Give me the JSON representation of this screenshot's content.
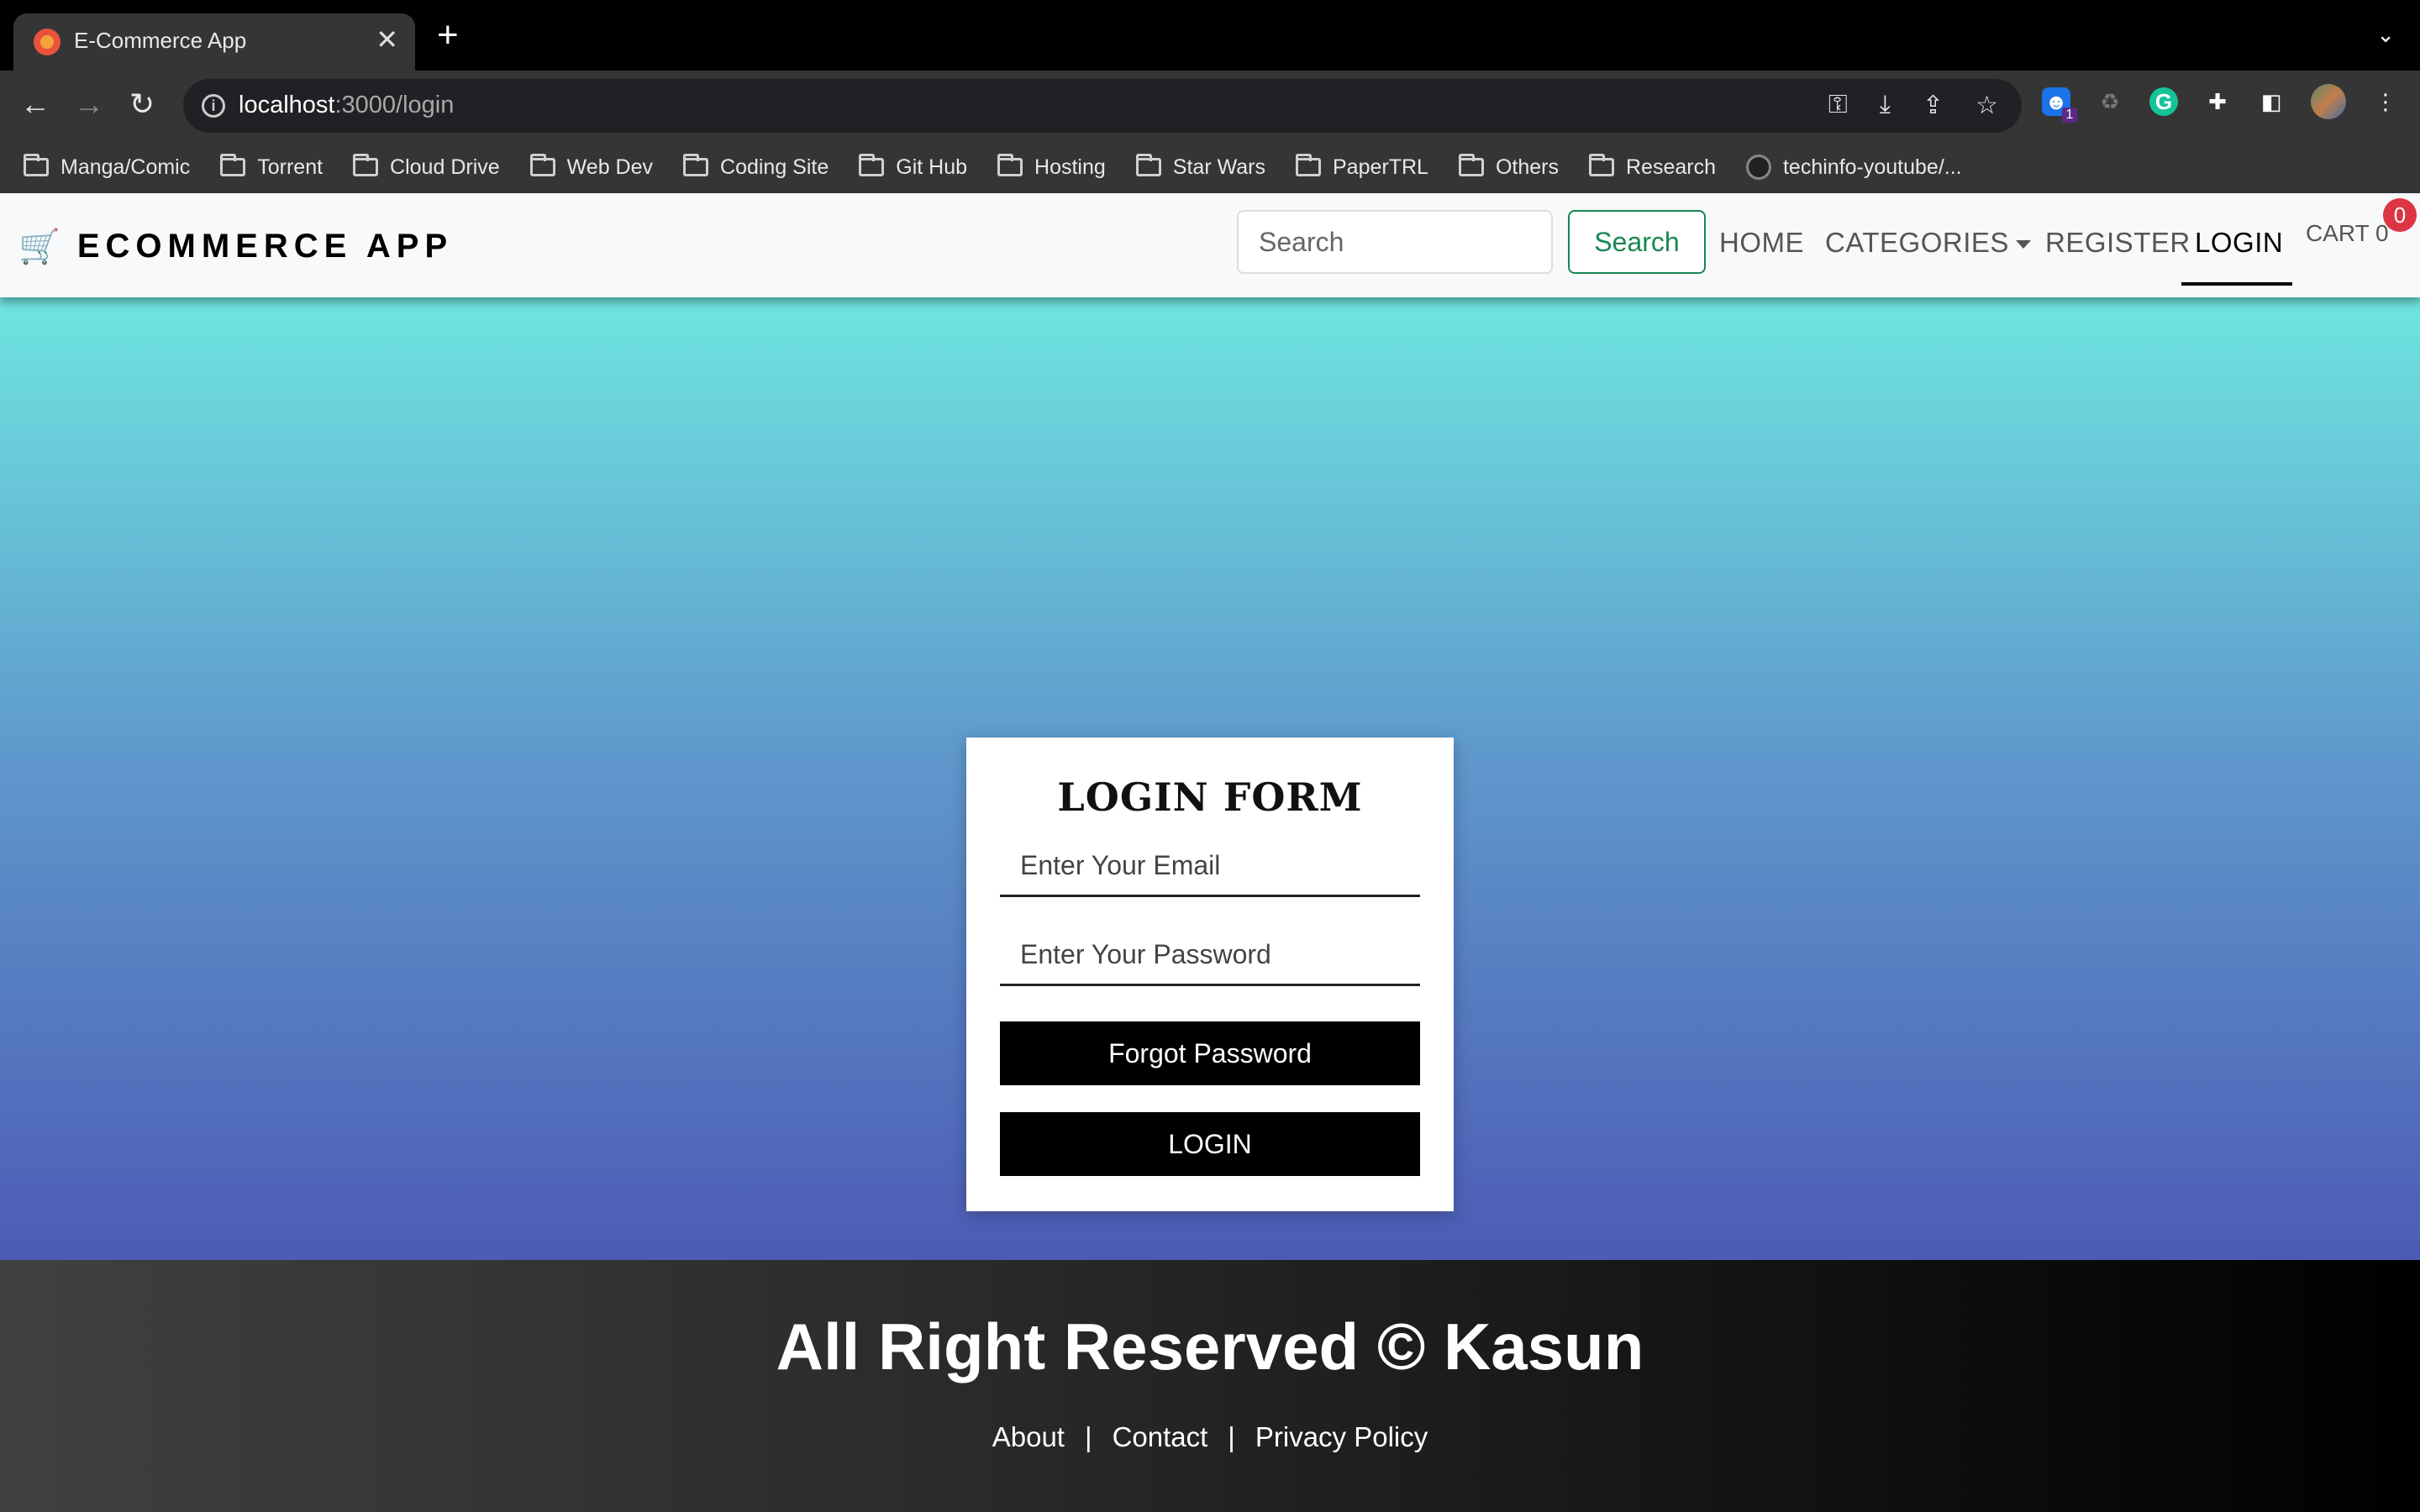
{
  "browser": {
    "tab_title": "E-Commerce App",
    "url_host": "localhost",
    "url_rest": ":3000/login",
    "extension_badge": "1",
    "bookmarks": [
      "Manga/Comic",
      "Torrent",
      "Cloud Drive",
      "Web Dev",
      "Coding Site",
      "Git Hub",
      "Hosting",
      "Star Wars",
      "PaperTRL",
      "Others",
      "Research"
    ],
    "bookmark_link": "techinfo-youtube/..."
  },
  "nav": {
    "brand": "ECOMMERCE APP",
    "search_placeholder": "Search",
    "search_button": "Search",
    "home": "HOME",
    "categories": "CATEGORIES",
    "register": "REGISTER",
    "login": "LOGIN",
    "cart": "CART 0",
    "cart_count": "0"
  },
  "form": {
    "heading": "LOGIN FORM",
    "email_placeholder": "Enter Your Email",
    "password_placeholder": "Enter Your Password",
    "forgot_button": "Forgot Password",
    "login_button": "LOGIN"
  },
  "footer": {
    "copyright": "All Right Reserved © Kasun",
    "about": "About",
    "contact": "Contact",
    "privacy": "Privacy Policy",
    "separator": "|"
  },
  "colors": {
    "gradient_top": "#6ee5e0",
    "gradient_bottom": "#4c5bb5",
    "search_button": "#198754",
    "badge": "#dc3545"
  }
}
